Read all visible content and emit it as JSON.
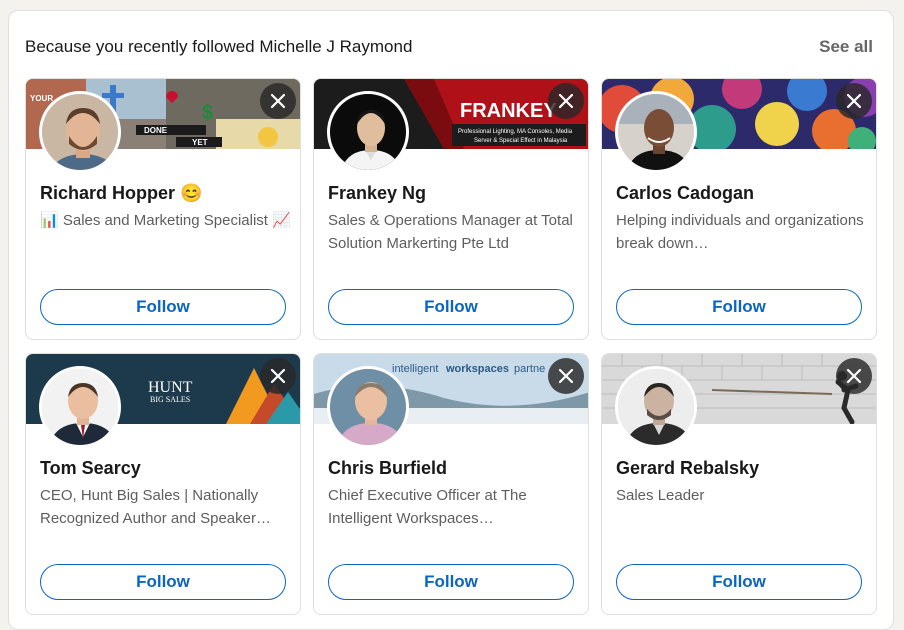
{
  "header": {
    "title": "Because you recently followed Michelle J Raymond",
    "see_all": "See all"
  },
  "cards": [
    {
      "name": "Richard Hopper 😊",
      "headline": "📊 Sales and Marketing Specialist 📈",
      "follow_label": "Follow",
      "banner_texts": {
        "a": "YOUR",
        "b": "DONE",
        "c": "YET"
      }
    },
    {
      "name": "Frankey Ng",
      "headline": "Sales & Operations Manager at Total Solution Markerting Pte Ltd",
      "follow_label": "Follow",
      "banner_texts": {
        "a": "FRANKEY",
        "b": "Professional Lighting, MA Consoles, Media",
        "c": "Server & Special Effect in Malaysia"
      }
    },
    {
      "name": "Carlos Cadogan",
      "headline": "Helping individuals and organizations break down…",
      "follow_label": "Follow"
    },
    {
      "name": "Tom Searcy",
      "headline": "CEO, Hunt Big Sales | Nationally Recognized Author and Speaker…",
      "follow_label": "Follow",
      "banner_texts": {
        "a": "HUNT",
        "b": "BIG SALES"
      }
    },
    {
      "name": "Chris Burfield",
      "headline": "Chief Executive Officer at The Intelligent Workspaces…",
      "follow_label": "Follow",
      "banner_texts": {
        "a": "intelligent",
        "b": "workspaces",
        "c": "partne"
      }
    },
    {
      "name": "Gerard Rebalsky",
      "headline": "Sales Leader",
      "follow_label": "Follow"
    }
  ],
  "colors": {
    "accent": "#0a66c2",
    "dismiss_bg": "#282828"
  },
  "icons": {
    "dismiss": "close-icon"
  }
}
